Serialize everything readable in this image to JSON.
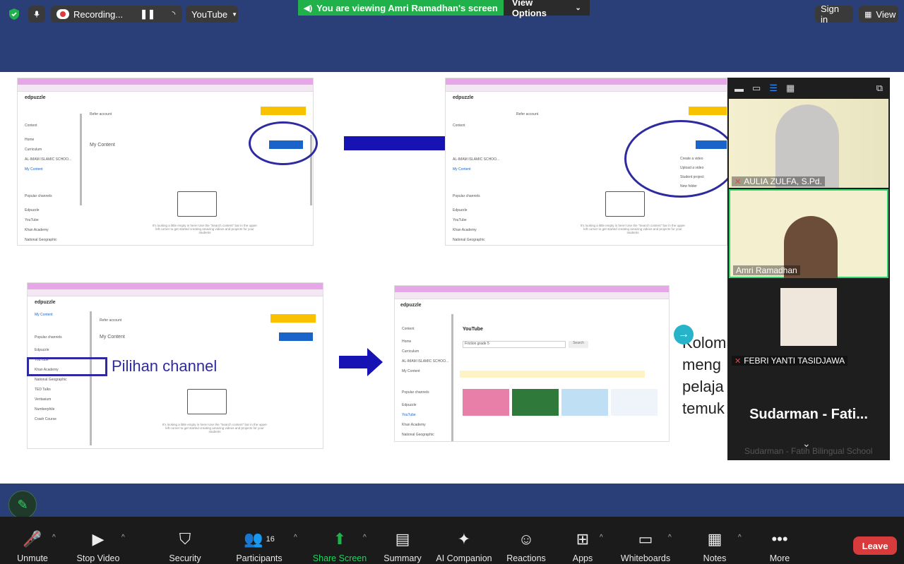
{
  "topbar": {
    "recording_label": "Recording...",
    "youtube_label": "YouTube",
    "viewing_banner": "You are viewing Amri Ramadhan's screen",
    "view_options_label": "View Options",
    "sign_in_label": "Sign in",
    "view_label": "View"
  },
  "slide": {
    "brand": "edpuzzle",
    "refer_label": "Refer to earn space",
    "my_content": "My Content",
    "add_content": "Add Content",
    "content_label": "Content",
    "home": "Home",
    "curriculum": "Curriculum",
    "school": "AL-IMAM ISLAMIC SCHOO...",
    "popular_channels": "Popular channels",
    "channels": [
      "Edpuzzle",
      "YouTube",
      "Khan Academy",
      "National Geographic",
      "TED Talks",
      "Veritasium",
      "Numberphile",
      "Crash Course"
    ],
    "dropdown_items": [
      "Create a video",
      "Upload a video",
      "Student project",
      "New folder"
    ],
    "empty_text": "It's looking a little empty in here! Use the \"Search content\" bar in the upper left corner to get started creating amazing videos and projects for your students",
    "pilihan_channel": "Pilihan channel",
    "youtube_logo": "YouTube",
    "yt_search_value": "Friction grade 5",
    "yt_search_btn": "Search",
    "kolom_lines": [
      "Kolom",
      "meng",
      "pelaja",
      "temuk"
    ]
  },
  "gallery": {
    "tiles": [
      {
        "name": "AULIA ZULFA, S.Pd.",
        "muted": true
      },
      {
        "name": "Amri Ramadhan",
        "muted": false
      },
      {
        "name": "FEBRI YANTI TASIDJAWA",
        "muted": true
      },
      {
        "name": "Sudarman - Fati...",
        "muted": false
      }
    ],
    "bottom_name": "Sudarman - Fatih Bilingual School"
  },
  "toolbar": {
    "unmute": "Unmute",
    "stop_video": "Stop Video",
    "security": "Security",
    "participants": "Participants",
    "participants_count": "16",
    "share_screen": "Share Screen",
    "summary": "Summary",
    "ai_companion": "AI Companion",
    "reactions": "Reactions",
    "apps": "Apps",
    "whiteboards": "Whiteboards",
    "notes": "Notes",
    "more": "More",
    "leave": "Leave"
  },
  "colors": {
    "accent_green": "#21b14b",
    "leave_red": "#d83b3b",
    "slide_blue": "#2a3f78"
  }
}
